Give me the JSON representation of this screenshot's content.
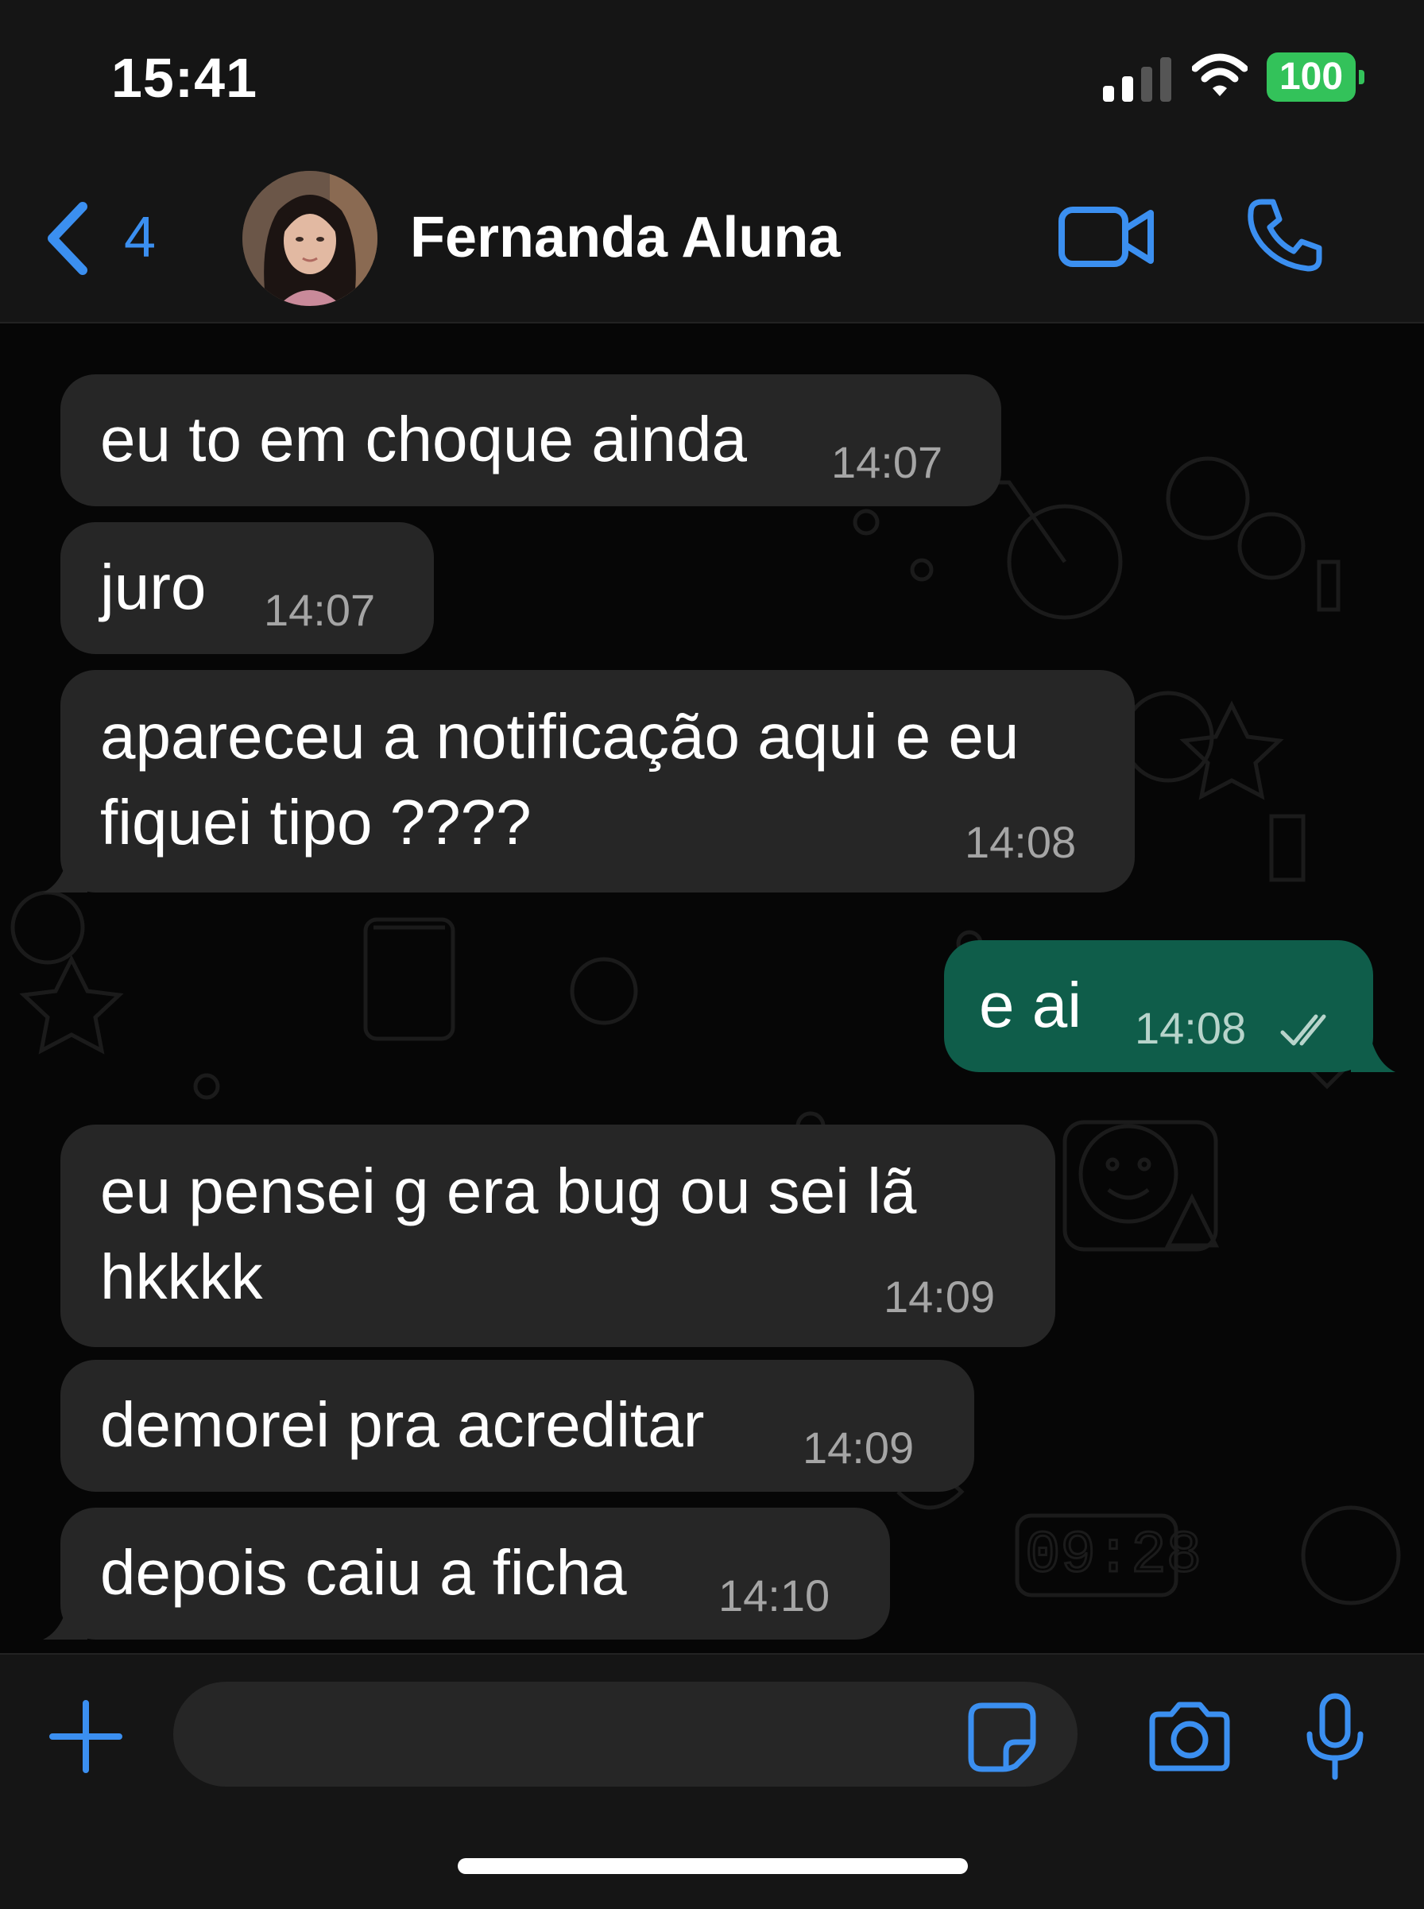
{
  "status_bar": {
    "time": "15:41",
    "battery": "100",
    "signal_bars_active": 2,
    "signal_bars_total": 4
  },
  "header": {
    "back_count": "4",
    "contact_name": "Fernanda Aluna"
  },
  "colors": {
    "accent": "#3b8ff0",
    "incoming_bubble": "#262626",
    "outgoing_bubble": "#0f5d4a",
    "battery": "#33c25a"
  },
  "messages": [
    {
      "direction": "in",
      "text": "eu to em choque ainda",
      "time": "14:07"
    },
    {
      "direction": "in",
      "text": "juro",
      "time": "14:07"
    },
    {
      "direction": "in",
      "text": "apareceu a notificação aqui e eu\nfiquei tipo ????",
      "time": "14:08"
    },
    {
      "direction": "out",
      "text": "e ai",
      "time": "14:08",
      "status": "read"
    },
    {
      "direction": "in",
      "text": "eu pensei g era bug ou sei lã\nhkkkk",
      "time": "14:09"
    },
    {
      "direction": "in",
      "text": "demorei pra acreditar",
      "time": "14:09"
    },
    {
      "direction": "in",
      "text": "depois caiu a ficha",
      "time": "14:10"
    }
  ],
  "wallpaper_clock": "09:28",
  "input": {
    "placeholder": ""
  },
  "icons": [
    "back-chevron-icon",
    "video-call-icon",
    "phone-icon",
    "plus-icon",
    "sticker-icon",
    "camera-icon",
    "microphone-icon",
    "read-ticks-icon",
    "wifi-icon",
    "signal-icon"
  ]
}
